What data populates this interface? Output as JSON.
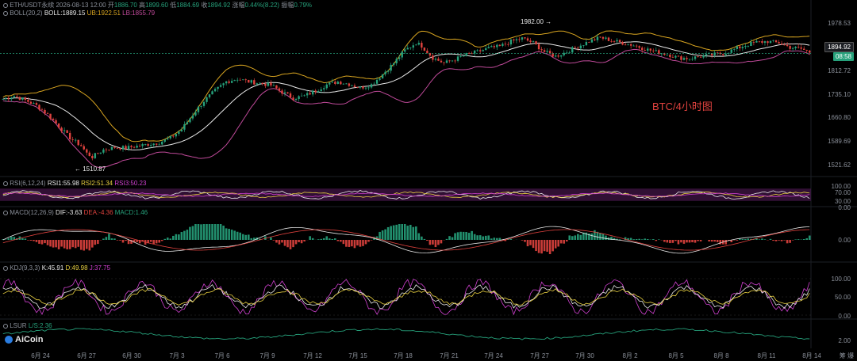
{
  "header": {
    "symbol": "ETH/USDT永续",
    "datetime": "2026-08-13 12:00",
    "open_label": "开",
    "open": "1886.70",
    "high_label": "高",
    "high": "1899.60",
    "low_label": "低",
    "low": "1884.69",
    "close_label": "收",
    "close": "1894.92",
    "change_label": "涨幅",
    "change": "0.44%(8.22)",
    "amp_label": "振幅",
    "amp": "0.79%"
  },
  "boll": {
    "name": "BOLL(20,2)",
    "mid": "BOLL:1889.15",
    "ub": "UB:1922.51",
    "lb": "LB:1855.79"
  },
  "rsi": {
    "name": "RSI(6,12,24)",
    "rsi1": "RSI1:55.98",
    "rsi2": "RSI2:51.34",
    "rsi3": "RSI3:50.23"
  },
  "macd": {
    "name": "MACD(12,26,9)",
    "dif": "DIF:-3.63",
    "dea": "DEA:-4.36",
    "macd": "MACD:1.46"
  },
  "kdj": {
    "name": "KDJ(9,3,3)",
    "k": "K:45.91",
    "d": "D:49.98",
    "j": "J:37.75"
  },
  "lsur": {
    "name": "LSUR",
    "val": "L/S:2.36"
  },
  "price_axis": [
    "1978.53",
    "1812.72",
    "1735.10",
    "1660.80",
    "1589.69",
    "1521.62"
  ],
  "current_price": "1894.92",
  "countdown": "08:58",
  "rsi_axis": [
    "100.00",
    "70.00",
    "30.00",
    "0.00"
  ],
  "macd_axis": [
    "0.00"
  ],
  "kdj_axis": [
    "100.00",
    "50.00",
    "0.00"
  ],
  "lsur_axis": [
    "2.00"
  ],
  "x_axis": [
    "6月 24",
    "6月 27",
    "6月 30",
    "7月 3",
    "7月 6",
    "7月 9",
    "7月 12",
    "7月 15",
    "7月 18",
    "7月 21",
    "7月 24",
    "7月 27",
    "7月 30",
    "8月 2",
    "8月 5",
    "8月 8",
    "8月 11",
    "8月 14"
  ],
  "annotations": {
    "high_marker": "1982.00",
    "low_marker": "1510.87"
  },
  "watermark": "BTC/4小时图",
  "logo": "AiCoin",
  "corner_label": "筹 爆",
  "colors": {
    "up": "#26a17b",
    "down": "#e0423e",
    "boll_mid": "#e8e8e8",
    "boll_ub": "#d9a520",
    "boll_lb": "#c04a9a",
    "rsi_band": "#5a1e5e"
  },
  "chart_data": {
    "type": "candlestick",
    "interval": "4h",
    "y_price_range": [
      1490,
      2010
    ],
    "close_path": [
      [
        0,
        1742
      ],
      [
        4,
        1752
      ],
      [
        8,
        1738
      ],
      [
        12,
        1720
      ],
      [
        16,
        1690
      ],
      [
        20,
        1650
      ],
      [
        24,
        1612
      ],
      [
        28,
        1585
      ],
      [
        30,
        1560
      ],
      [
        32,
        1548
      ],
      [
        36,
        1572
      ],
      [
        40,
        1580
      ],
      [
        44,
        1578
      ],
      [
        48,
        1584
      ],
      [
        52,
        1590
      ],
      [
        56,
        1596
      ],
      [
        60,
        1612
      ],
      [
        64,
        1640
      ],
      [
        68,
        1690
      ],
      [
        72,
        1735
      ],
      [
        76,
        1770
      ],
      [
        80,
        1800
      ],
      [
        84,
        1810
      ],
      [
        88,
        1800
      ],
      [
        92,
        1795
      ],
      [
        96,
        1788
      ],
      [
        100,
        1765
      ],
      [
        104,
        1745
      ],
      [
        108,
        1752
      ],
      [
        112,
        1770
      ],
      [
        116,
        1790
      ],
      [
        120,
        1800
      ],
      [
        124,
        1792
      ],
      [
        128,
        1780
      ],
      [
        132,
        1790
      ],
      [
        136,
        1825
      ],
      [
        140,
        1862
      ],
      [
        144,
        1905
      ],
      [
        148,
        1930
      ],
      [
        150,
        1920
      ],
      [
        154,
        1880
      ],
      [
        158,
        1862
      ],
      [
        162,
        1875
      ],
      [
        166,
        1890
      ],
      [
        170,
        1900
      ],
      [
        174,
        1912
      ],
      [
        178,
        1918
      ],
      [
        182,
        1935
      ],
      [
        186,
        1945
      ],
      [
        190,
        1930
      ],
      [
        194,
        1900
      ],
      [
        198,
        1885
      ],
      [
        202,
        1900
      ],
      [
        206,
        1918
      ],
      [
        210,
        1935
      ],
      [
        214,
        1948
      ],
      [
        218,
        1938
      ],
      [
        222,
        1930
      ],
      [
        226,
        1922
      ],
      [
        230,
        1910
      ],
      [
        234,
        1900
      ],
      [
        238,
        1892
      ],
      [
        242,
        1880
      ],
      [
        246,
        1878
      ],
      [
        250,
        1885
      ],
      [
        254,
        1890
      ],
      [
        258,
        1895
      ],
      [
        262,
        1908
      ],
      [
        266,
        1922
      ],
      [
        270,
        1932
      ],
      [
        274,
        1935
      ],
      [
        278,
        1930
      ],
      [
        282,
        1915
      ],
      [
        286,
        1910
      ],
      [
        290,
        1895
      ]
    ],
    "high_point": 1982.0,
    "low_point": 1510.87,
    "last_close": 1894.92
  }
}
